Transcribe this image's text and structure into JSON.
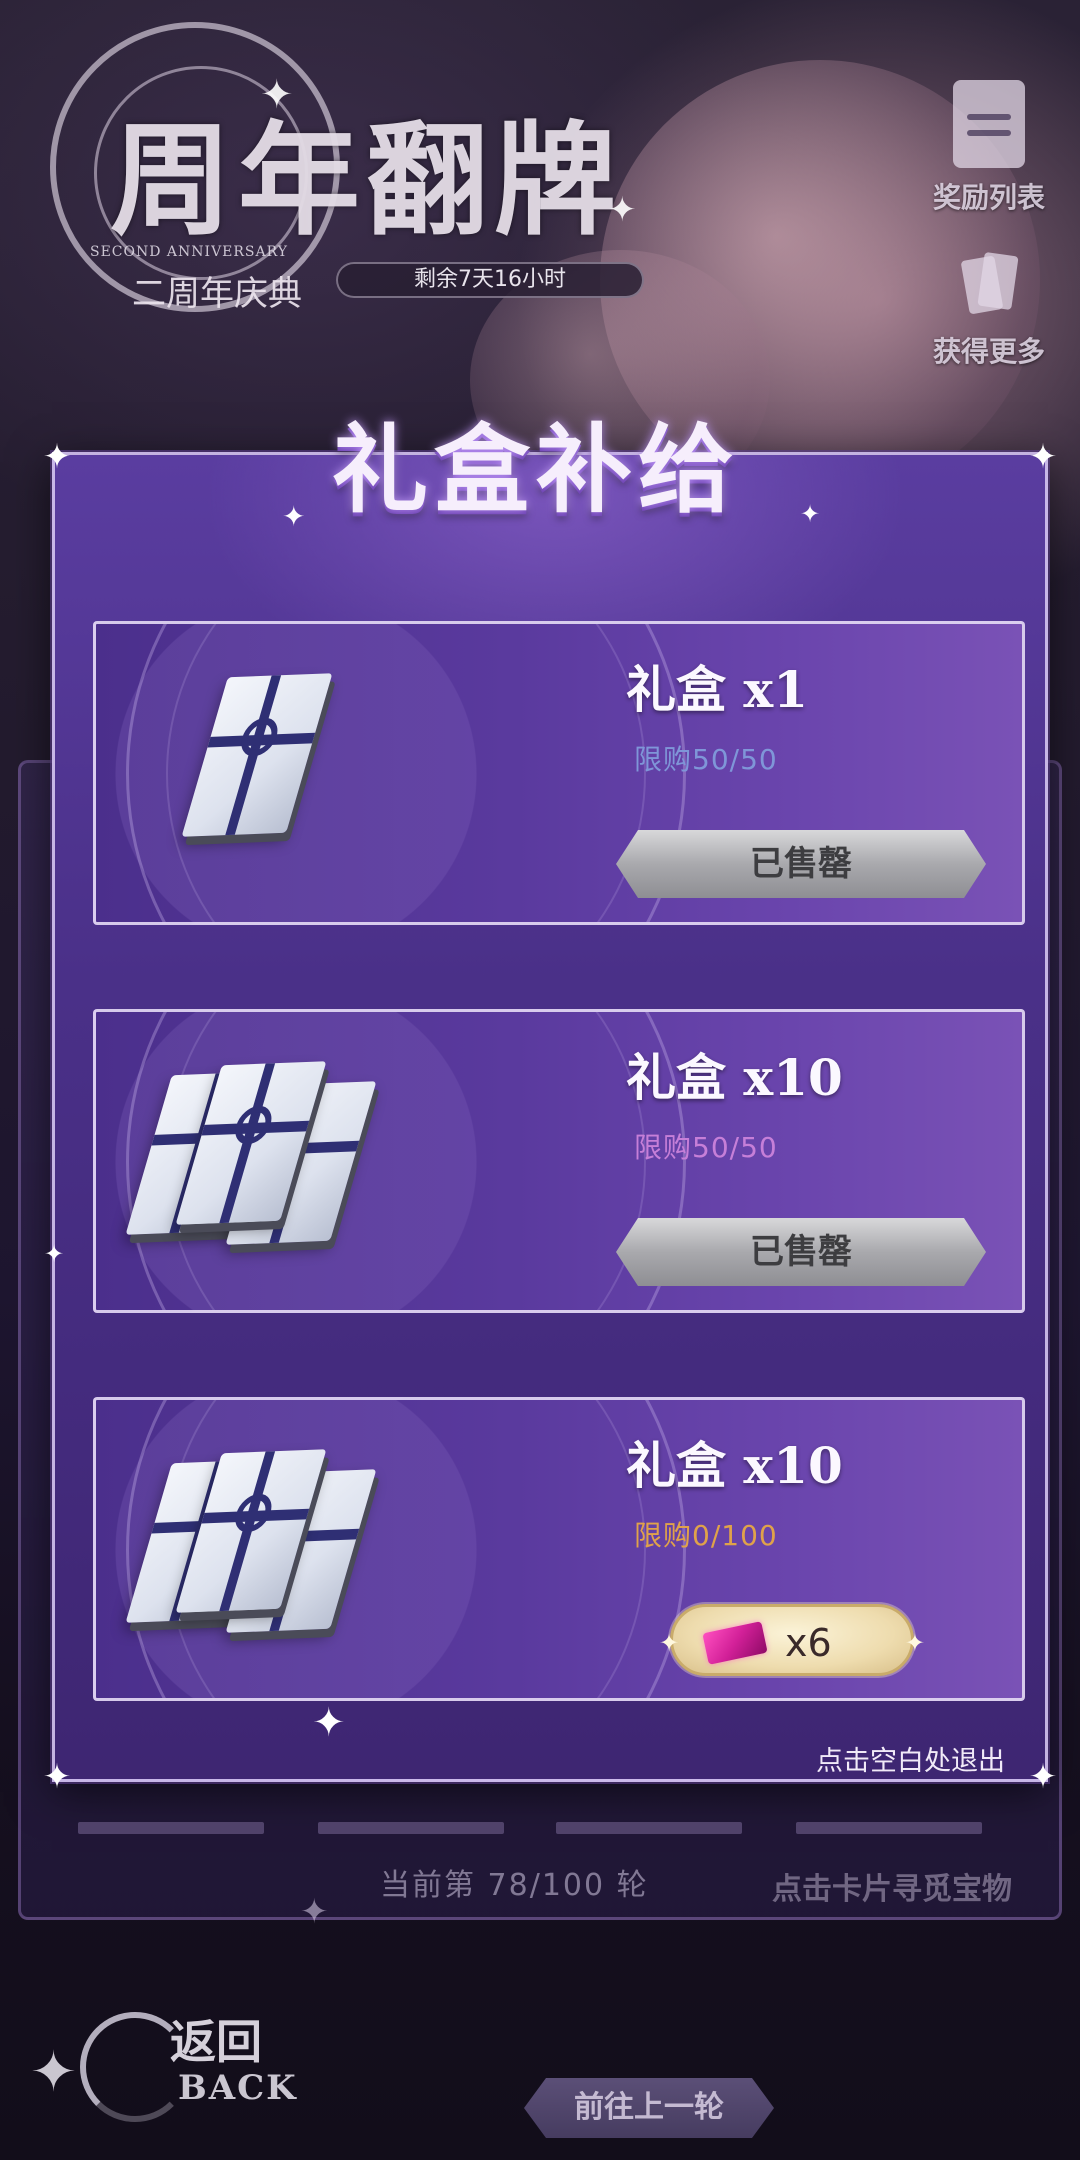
{
  "event": {
    "title": "周年翻牌",
    "subtitle_en": "SECOND ANNIVERSARY",
    "subtitle_cn": "二周年庆典",
    "countdown": "剩余7天16小时"
  },
  "side_buttons": {
    "reward_list": "奖励列表",
    "get_more": "获得更多"
  },
  "modal": {
    "title": "礼盒补给",
    "exit_hint": "点击空白处退出",
    "items": [
      {
        "name": "礼盒 x1",
        "limit": "限购50/50",
        "limit_color": "#7f96d8",
        "button_label": "已售罄",
        "state": "sold_out",
        "icon": "gift-box-single-icon"
      },
      {
        "name": "礼盒 x10",
        "limit": "限购50/50",
        "limit_color": "#c67fd8",
        "button_label": "已售罄",
        "state": "sold_out",
        "icon": "gift-box-bundle-icon"
      },
      {
        "name": "礼盒 x10",
        "limit": "限购0/100",
        "limit_color": "#e0a24a",
        "cost": "x6",
        "cost_icon": "pink-ticket-icon",
        "state": "available",
        "icon": "gift-box-bundle-icon"
      }
    ]
  },
  "footer": {
    "round_info": "当前第 78/100 轮",
    "find_hint": "点击卡片寻觅宝物",
    "back_cn": "返回",
    "back_en": "BACK",
    "prev_round": "前往上一轮"
  },
  "colors": {
    "modal_bg": "#4a3088",
    "card_border": "#e6dcf5",
    "soldout_gray": "#a9a9ad",
    "buy_gold": "#eedcae",
    "ticket_pink": "#d22098"
  }
}
